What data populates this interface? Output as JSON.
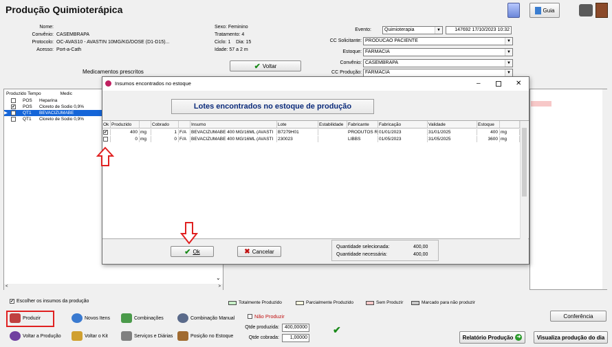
{
  "app": {
    "title": "Produção Quimioterápica",
    "guia": "Guia"
  },
  "patient": {
    "nome_label": "Nome:",
    "convenio_label": "Convênio:",
    "convenio": "CASEMBRAPA",
    "protocolo_label": "Protocolo:",
    "protocolo": "OC-AVAS10 - AVASTIN 10MG/KG/DOSE (D1-D15)...",
    "acesso_label": "Acesso:",
    "acesso": "Port-a-Cath",
    "sexo": "Sexo: Feminino",
    "tratamento": "Tratamento: 4",
    "ciclo": "Ciclo: 1",
    "dia": "Dia: 15",
    "idade": "Idade: 57 a 2 m"
  },
  "voltar": "Voltar",
  "meds_title": "Medicamentos prescritos",
  "form": {
    "evento_label": "Evento:",
    "evento": "Quimioterapia",
    "evento_num": "147692",
    "evento_date": "17/10/2023 10:32",
    "cc_sol_label": "CC Solicitante:",
    "cc_sol": "PRODUCAO PACIENTE",
    "estoque_label": "Estoque:",
    "estoque": "FARMACIA",
    "convenio_label": "Convênio:",
    "convenio": "CASEMBRAPA",
    "cc_prod_label": "CC Produção:",
    "cc_prod": "FARMACIA"
  },
  "grid": {
    "headers": [
      "Produzido",
      "Tempo",
      "Medic"
    ],
    "rows": [
      {
        "checked": false,
        "tempo": "POS",
        "med": "Heparina",
        "selected": false
      },
      {
        "checked": true,
        "tempo": "POS",
        "med": "Cloreto de Sodio 0,9%",
        "selected": false
      },
      {
        "checked": false,
        "tempo": "QT1",
        "med": "BEVACIZUMABE",
        "selected": true
      },
      {
        "checked": false,
        "tempo": "QT1",
        "med": "Cloreto de Sodio 0,9%",
        "selected": false
      }
    ]
  },
  "dialog": {
    "title": "Insumos encontrados no estoque",
    "banner": "Lotes encontrados no estoque de produção",
    "headers": [
      "Ok",
      "Produzido",
      "",
      "Cobrado",
      "",
      "Insumo",
      "Lote",
      "Estabilidade",
      "Fabricante",
      "Fabricação",
      "Validade",
      "Estoque",
      ""
    ],
    "rows": [
      {
        "ok": true,
        "produzido": "400",
        "un": "mg",
        "cobrado": "1",
        "un2": "F/A",
        "insumo": "BEVACIZUMABE 400 MG/16ML (AVASTI",
        "lote": "B7279H01",
        "estab": "",
        "fabricante": "PRODUTOS R",
        "fabricacao": "01/01/2023",
        "validade": "31/01/2025",
        "estoque": "400",
        "un3": "mg"
      },
      {
        "ok": false,
        "produzido": "0",
        "un": "mg",
        "cobrado": "0",
        "un2": "F/A",
        "insumo": "BEVACIZUMABE 400 MG/16ML (AVASTI",
        "lote": "230023",
        "estab": "",
        "fabricante": "LIBBS",
        "fabricacao": "01/05/2023",
        "validade": "31/05/2025",
        "estoque": "3600",
        "un3": "mg"
      }
    ],
    "ok_btn": "Ok",
    "cancel_btn": "Cancelar",
    "qtd_sel_label": "Quantidade selecionada:",
    "qtd_sel": "400,00",
    "qtd_nec_label": "Quantidade necessária:",
    "qtd_nec": "400,00"
  },
  "bottom": {
    "escolher": "Escolher os insumos da produção",
    "legend": [
      {
        "label": "Totalmente Produzido",
        "color": "#c8f0c8"
      },
      {
        "label": "Parcialmente Produzido",
        "color": "#ffffe0"
      },
      {
        "label": "Sem Produzir",
        "color": "#f7c8c8"
      },
      {
        "label": "Marcado para não produzir",
        "color": "#c8c8c8"
      }
    ],
    "produzir": "Produzir",
    "novos_itens": "Novos Itens",
    "combinacoes": "Combinações",
    "combinacao_manual": "Combinação Manual",
    "nao_produzir": "Não Produzir",
    "qtde_produzida_label": "Qtde produzida:",
    "qtde_produzida": "400,00000",
    "qtde_cobrada_label": "Qtde cobrada:",
    "qtde_cobrada": "1,00000",
    "conferencia": "Conferência",
    "voltar_producao": "Voltar a Produção",
    "voltar_kit": "Voltar o Kit",
    "servicos": "Serviços e Diárias",
    "posicao": "Posição no Estoque",
    "relatorio": "Relatório Produção",
    "visualiza": "Visualiza produção do dia"
  }
}
